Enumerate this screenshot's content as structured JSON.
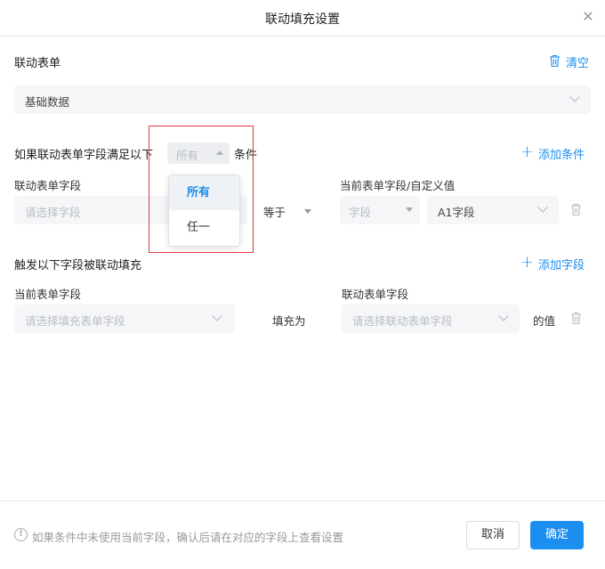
{
  "dialog": {
    "title": "联动填充设置"
  },
  "linked_form": {
    "label": "联动表单",
    "clear_label": "清空",
    "value": "基础数据"
  },
  "condition": {
    "prefix": "如果联动表单字段满足以下",
    "match_value": "所有",
    "suffix": "条件",
    "add_label": "添加条件",
    "col_linked_field": "联动表单字段",
    "col_current_field": "当前表单字段/自定义值",
    "linked_field_placeholder": "请选择字段",
    "operator": "等于",
    "type_value": "字段",
    "field_value": "A1字段",
    "dropdown_options": [
      "所有",
      "任一"
    ]
  },
  "fill": {
    "label": "触发以下字段被联动填充",
    "add_label": "添加字段",
    "col_current_field": "当前表单字段",
    "col_linked_field": "联动表单字段",
    "current_placeholder": "请选择填充表单字段",
    "fill_as": "填充为",
    "linked_placeholder": "请选择联动表单字段",
    "value_suffix": "的值"
  },
  "footer": {
    "hint": "如果条件中未使用当前字段，确认后请在对应的字段上查看设置",
    "cancel_label": "取消",
    "ok_label": "确定"
  },
  "colors": {
    "accent": "#1b8ef0",
    "highlight": "#e23b3b"
  }
}
